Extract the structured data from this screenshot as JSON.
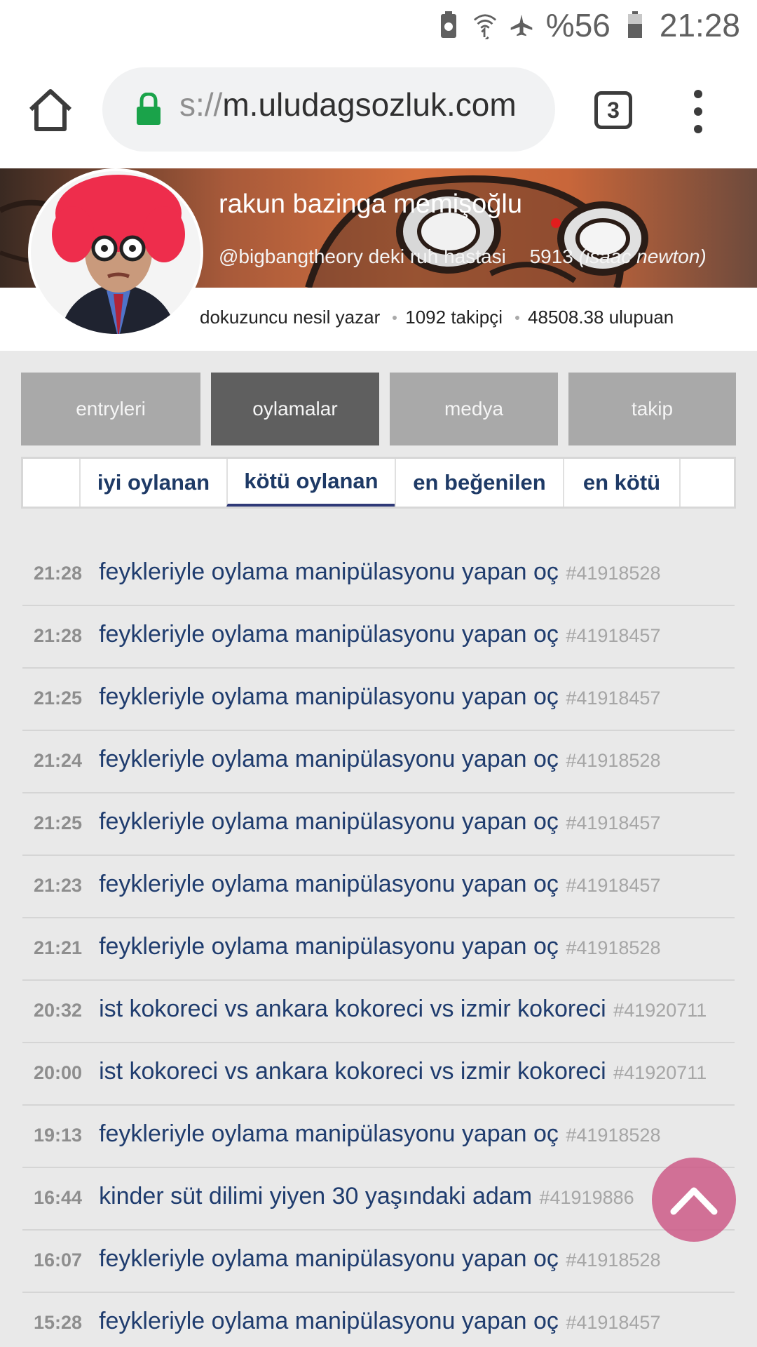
{
  "status_bar": {
    "battery_text": "%56",
    "clock": "21:28",
    "icons": [
      "recycle-icon",
      "wifi-icon",
      "airplane-mode-icon",
      "battery-icon"
    ]
  },
  "browser": {
    "url_fade": "s://",
    "url_main": "m.uludagsozluk.com",
    "tab_count": "3",
    "icons": [
      "home-icon",
      "lock-icon",
      "tabs-icon",
      "more-vert-icon"
    ]
  },
  "profile": {
    "name": "rakun bazinga memişoğlu",
    "handle": "@bigbangtheory deki ruh hastasi",
    "rank_number": "5913",
    "rank_title": "(isaac newton)",
    "level": "dokuzuncu nesil yazar",
    "followers": "1092 takipçi",
    "points": "48508.38 ulupuan"
  },
  "main_tabs": [
    {
      "label": "entryleri",
      "active": false
    },
    {
      "label": "oylamalar",
      "active": true
    },
    {
      "label": "medya",
      "active": false
    },
    {
      "label": "takip",
      "active": false
    }
  ],
  "sub_tabs": [
    {
      "label": "iyi oylanan",
      "active": false
    },
    {
      "label": "kötü oylanan",
      "active": true
    },
    {
      "label": "en beğenilen",
      "active": false
    },
    {
      "label": "en kötü",
      "active": false
    }
  ],
  "entries": [
    {
      "time": "21:28",
      "title": "feykleriyle oylama manipülasyonu yapan oç",
      "id": "#41918528"
    },
    {
      "time": "21:28",
      "title": "feykleriyle oylama manipülasyonu yapan oç",
      "id": "#41918457"
    },
    {
      "time": "21:25",
      "title": "feykleriyle oylama manipülasyonu yapan oç",
      "id": "#41918457"
    },
    {
      "time": "21:24",
      "title": "feykleriyle oylama manipülasyonu yapan oç",
      "id": "#41918528"
    },
    {
      "time": "21:25",
      "title": "feykleriyle oylama manipülasyonu yapan oç",
      "id": "#41918457"
    },
    {
      "time": "21:23",
      "title": "feykleriyle oylama manipülasyonu yapan oç",
      "id": "#41918457"
    },
    {
      "time": "21:21",
      "title": "feykleriyle oylama manipülasyonu yapan oç",
      "id": "#41918528"
    },
    {
      "time": "20:32",
      "title": "ist kokoreci vs ankara kokoreci vs izmir kokoreci",
      "id": "#41920711"
    },
    {
      "time": "20:00",
      "title": "ist kokoreci vs ankara kokoreci vs izmir kokoreci",
      "id": "#41920711"
    },
    {
      "time": "19:13",
      "title": "feykleriyle oylama manipülasyonu yapan oç",
      "id": "#41918528"
    },
    {
      "time": "16:44",
      "title": "kinder süt dilimi yiyen 30 yaşındaki adam",
      "id": "#41919886"
    },
    {
      "time": "16:07",
      "title": "feykleriyle oylama manipülasyonu yapan oç",
      "id": "#41918528"
    },
    {
      "time": "15:28",
      "title": "feykleriyle oylama manipülasyonu yapan oç",
      "id": "#41918457"
    }
  ],
  "colors": {
    "link": "#1f3c6e",
    "tab_active": "#5f5f5f",
    "tab_inactive": "#a9a9a9",
    "scroll_top": "#cd5a87"
  }
}
